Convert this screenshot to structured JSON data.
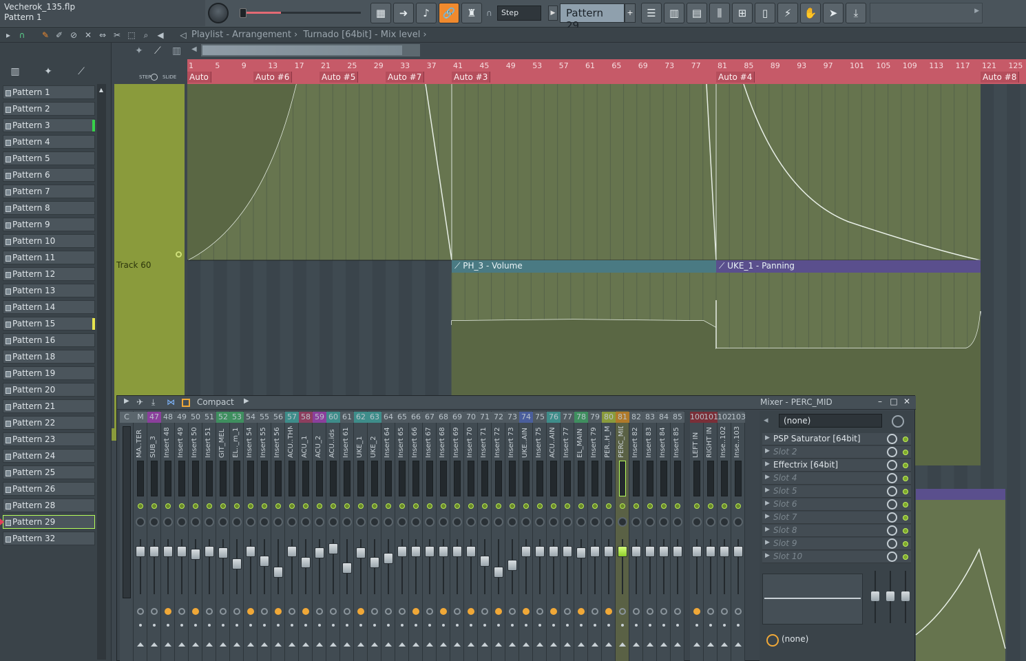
{
  "project": {
    "filename": "Vecherok_135.flp",
    "current_pattern_hint": "Pattern 1"
  },
  "toolbar": {
    "snap_label": "Step",
    "pattern_selector": "Pattern 29",
    "add_pattern_symbol": "+",
    "accent_color": "#f08a2e"
  },
  "breadcrumb": {
    "parts": [
      "Playlist - Arrangement",
      "Turnado [64bit] - Mix level"
    ]
  },
  "browser": {
    "patterns": [
      {
        "label": "Pattern 1"
      },
      {
        "label": "Pattern 2"
      },
      {
        "label": "Pattern 3",
        "mark": "#37d14a"
      },
      {
        "label": "Pattern 4"
      },
      {
        "label": "Pattern 5"
      },
      {
        "label": "Pattern 6"
      },
      {
        "label": "Pattern 7"
      },
      {
        "label": "Pattern 8"
      },
      {
        "label": "Pattern 9"
      },
      {
        "label": "Pattern 10"
      },
      {
        "label": "Pattern 11"
      },
      {
        "label": "Pattern 12"
      },
      {
        "label": "Pattern 13"
      },
      {
        "label": "Pattern 14"
      },
      {
        "label": "Pattern 15",
        "mark": "#e7e44e"
      },
      {
        "label": "Pattern 16"
      },
      {
        "label": "Pattern 18"
      },
      {
        "label": "Pattern 19"
      },
      {
        "label": "Pattern 20"
      },
      {
        "label": "Pattern 21"
      },
      {
        "label": "Pattern 22"
      },
      {
        "label": "Pattern 23"
      },
      {
        "label": "Pattern 24"
      },
      {
        "label": "Pattern 25"
      },
      {
        "label": "Pattern 26"
      },
      {
        "label": "Pattern 28"
      },
      {
        "label": "Pattern 29",
        "selected": true
      },
      {
        "label": "Pattern 32"
      }
    ]
  },
  "playlist": {
    "step_label": "STEP",
    "slide_label": "SLIDE",
    "track_label": "Track 60",
    "ruler_ticks": [
      "1",
      "5",
      "9",
      "13",
      "17",
      "21",
      "25",
      "29",
      "33",
      "37",
      "41",
      "45",
      "49",
      "53",
      "57",
      "61",
      "65",
      "69",
      "73",
      "77",
      "81",
      "85",
      "89",
      "93",
      "97",
      "101",
      "105",
      "109",
      "113",
      "117",
      "121",
      "125"
    ],
    "auto_labels": [
      {
        "label": "Auto",
        "bar": 1
      },
      {
        "label": "Auto #6",
        "bar": 11
      },
      {
        "label": "Auto #5",
        "bar": 21
      },
      {
        "label": "Auto #7",
        "bar": 31
      },
      {
        "label": "Auto #3",
        "bar": 41
      },
      {
        "label": "Auto #4",
        "bar": 81
      },
      {
        "label": "Auto #8",
        "bar": 121
      }
    ],
    "clips": [
      {
        "label": "PH_3 - Volume",
        "color": "#4a7a83"
      },
      {
        "label": "UKE_1 - Panning",
        "color": "#5a4f8d"
      }
    ]
  },
  "mixer": {
    "title": "Mixer - PERC_MID",
    "mode_label": "Compact",
    "channels": [
      {
        "num": "C",
        "name": "",
        "color": "#5b666d"
      },
      {
        "num": "M",
        "name": "MA..TER",
        "color": "#5b666d"
      },
      {
        "num": "47",
        "name": "SUB_3",
        "color": "#8b3f9c"
      },
      {
        "num": "48",
        "name": "Insert 48",
        "color": "#505a61"
      },
      {
        "num": "49",
        "name": "Insert 49",
        "color": "#505a61"
      },
      {
        "num": "50",
        "name": "Insert 50",
        "color": "#505a61"
      },
      {
        "num": "51",
        "name": "Insert 51",
        "color": "#505a61"
      },
      {
        "num": "52",
        "name": "GIT_MEL",
        "color": "#3f8f5f"
      },
      {
        "num": "53",
        "name": "EL.._m_1",
        "color": "#3f8f5f"
      },
      {
        "num": "54",
        "name": "Insert 54",
        "color": "#505a61"
      },
      {
        "num": "55",
        "name": "Insert 55",
        "color": "#505a61"
      },
      {
        "num": "56",
        "name": "Insert 56",
        "color": "#505a61"
      },
      {
        "num": "57",
        "name": "ACU..THM",
        "color": "#3e8d8a"
      },
      {
        "num": "58",
        "name": "ACU_1",
        "color": "#8d3e5e"
      },
      {
        "num": "59",
        "name": "ACU_2",
        "color": "#8b3f9c"
      },
      {
        "num": "60",
        "name": "ACU..ids",
        "color": "#3e8d8a"
      },
      {
        "num": "61",
        "name": "Insert 61",
        "color": "#505a61"
      },
      {
        "num": "62",
        "name": "UKE_1",
        "color": "#3e8d8a"
      },
      {
        "num": "63",
        "name": "UKE_2",
        "color": "#3e8d8a"
      },
      {
        "num": "64",
        "name": "Insert 64",
        "color": "#505a61"
      },
      {
        "num": "65",
        "name": "Insert 65",
        "color": "#505a61"
      },
      {
        "num": "66",
        "name": "Insert 66",
        "color": "#505a61"
      },
      {
        "num": "67",
        "name": "Insert 67",
        "color": "#505a61"
      },
      {
        "num": "68",
        "name": "Insert 68",
        "color": "#505a61"
      },
      {
        "num": "69",
        "name": "Insert 69",
        "color": "#505a61"
      },
      {
        "num": "70",
        "name": "Insert 70",
        "color": "#505a61"
      },
      {
        "num": "71",
        "name": "Insert 71",
        "color": "#505a61"
      },
      {
        "num": "72",
        "name": "Insert 72",
        "color": "#505a61"
      },
      {
        "num": "73",
        "name": "Insert 73",
        "color": "#505a61"
      },
      {
        "num": "74",
        "name": "UKE..AIN",
        "color": "#4a5e9c"
      },
      {
        "num": "75",
        "name": "Insert 75",
        "color": "#505a61"
      },
      {
        "num": "76",
        "name": "ACU..AIN",
        "color": "#3e8d8a"
      },
      {
        "num": "77",
        "name": "Insert 77",
        "color": "#505a61"
      },
      {
        "num": "78",
        "name": "EL_MAIN",
        "color": "#3f8f5f"
      },
      {
        "num": "79",
        "name": "Insert 79",
        "color": "#505a61"
      },
      {
        "num": "80",
        "name": "PER..H_M",
        "color": "#8a9b3c"
      },
      {
        "num": "81",
        "name": "PERC_MID",
        "color": "#b07a2a",
        "selected": true
      },
      {
        "num": "82",
        "name": "Insert 82",
        "color": "#505a61"
      },
      {
        "num": "83",
        "name": "Insert 83",
        "color": "#505a61"
      },
      {
        "num": "84",
        "name": "Insert 84",
        "color": "#505a61"
      },
      {
        "num": "85",
        "name": "Insert 85",
        "color": "#505a61"
      },
      {
        "num": "100",
        "name": "LEFT IN",
        "color": "#7a2f38"
      },
      {
        "num": "101",
        "name": "RIGHT IN",
        "color": "#7a2f38"
      },
      {
        "num": "102",
        "name": "Inse..102",
        "color": "#505a61"
      },
      {
        "num": "103",
        "name": "Inse..103",
        "color": "#505a61"
      }
    ],
    "fx": {
      "input": "(none)",
      "slots": [
        {
          "label": "PSP Saturator [64bit]",
          "empty": false
        },
        {
          "label": "Slot 2",
          "empty": true
        },
        {
          "label": "Effectrix [64bit]",
          "empty": false
        },
        {
          "label": "Slot 4",
          "empty": true
        },
        {
          "label": "Slot 5",
          "empty": true
        },
        {
          "label": "Slot 6",
          "empty": true
        },
        {
          "label": "Slot 7",
          "empty": true
        },
        {
          "label": "Slot 8",
          "empty": true
        },
        {
          "label": "Slot 9",
          "empty": true
        },
        {
          "label": "Slot 10",
          "empty": true
        }
      ],
      "output": "(none)"
    }
  }
}
